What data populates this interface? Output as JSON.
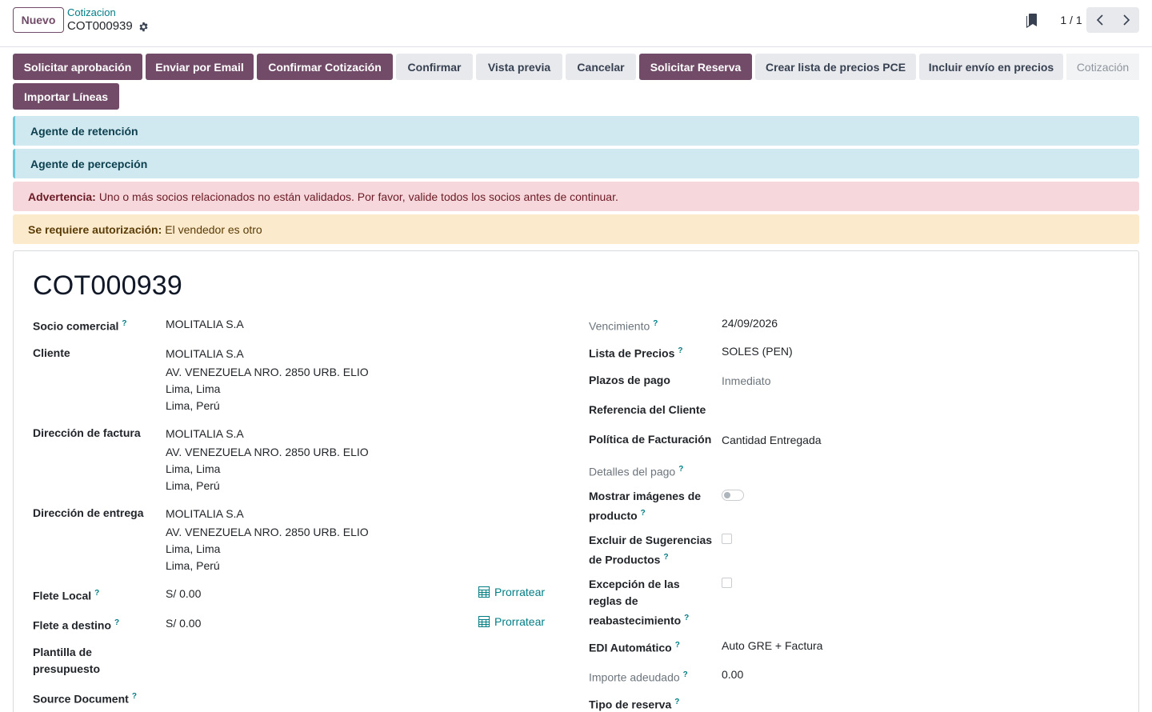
{
  "control_panel": {
    "new_button": "Nuevo",
    "breadcrumb_parent": "Cotizacion",
    "breadcrumb_current": "COT000939",
    "pager_value": "1 / 1"
  },
  "actions": {
    "solicitar_aprobacion": "Solicitar aprobación",
    "enviar_email": "Enviar por Email",
    "confirmar_cotizacion": "Confirmar Cotización",
    "confirmar": "Confirmar",
    "vista_previa": "Vista previa",
    "cancelar": "Cancelar",
    "solicitar_reserva": "Solicitar Reserva",
    "crear_lista_precios": "Crear lista de precios PCE",
    "incluir_envio": "Incluir envío en precios",
    "importar_lineas": "Importar Líneas",
    "status": "Cotización"
  },
  "alerts": {
    "retencion": "Agente de retención",
    "percepcion": "Agente de percepción",
    "advertencia_title": "Advertencia:",
    "advertencia_text": "Uno o más socios relacionados no están validados. Por favor, valide todos los socios antes de continuar.",
    "autorizacion_title": "Se requiere autorización:",
    "autorizacion_text": "El vendedor es otro"
  },
  "form": {
    "title": "COT000939",
    "help_mark": "?",
    "left": {
      "socio_label": "Socio comercial",
      "socio_value": "MOLITALIA S.A",
      "cliente_label": "Cliente",
      "cliente_lines": [
        "MOLITALIA S.A",
        "AV. VENEZUELA NRO. 2850 URB. ELIO",
        "Lima, Lima",
        "Lima, Perú"
      ],
      "factura_label": "Dirección de factura",
      "factura_lines": [
        "MOLITALIA S.A",
        "AV. VENEZUELA NRO. 2850 URB. ELIO",
        "Lima, Lima",
        "Lima, Perú"
      ],
      "entrega_label": "Dirección de entrega",
      "entrega_lines": [
        "MOLITALIA S.A",
        "AV. VENEZUELA NRO. 2850 URB. ELIO",
        "Lima, Lima",
        "Lima, Perú"
      ],
      "flete_local_label": "Flete Local",
      "flete_local_value": "S/ 0.00",
      "flete_destino_label": "Flete a destino",
      "flete_destino_value": "S/ 0.00",
      "prorratear": "Prorratear",
      "plantilla_label_1": "Plantilla de",
      "plantilla_label_2": "presupuesto",
      "source_label": "Source Document"
    },
    "right": {
      "vencimiento_label": "Vencimiento",
      "vencimiento_value": "24/09/2026",
      "lista_label": "Lista de Precios",
      "lista_value": "SOLES (PEN)",
      "plazos_label": "Plazos de pago",
      "plazos_value": "Inmediato",
      "referencia_label": "Referencia del Cliente",
      "politica_label": "Política de Facturación",
      "politica_value": "Cantidad Entregada",
      "detalles_label": "Detalles del pago",
      "mostrar_label_1": "Mostrar imágenes de",
      "mostrar_label_2": "producto",
      "mostrar_value": false,
      "excluir_label_1": "Excluir de Sugerencias",
      "excluir_label_2": "de Productos",
      "excluir_value": false,
      "excepcion_label_1": "Excepción de las",
      "excepcion_label_2": "reglas de",
      "excepcion_label_3": "reabastecimiento",
      "excepcion_value": false,
      "edi_label": "EDI Automático",
      "edi_value": "Auto GRE + Factura",
      "importe_label": "Importe adeudado",
      "importe_value": "0.00",
      "tipo_reserva_label": "Tipo de reserva"
    }
  },
  "colors": {
    "primary": "#714b67",
    "link": "#017e84",
    "info_bg": "#d0e8ef",
    "danger_bg": "#f6d8dc",
    "warning_bg": "#fbeacc"
  }
}
